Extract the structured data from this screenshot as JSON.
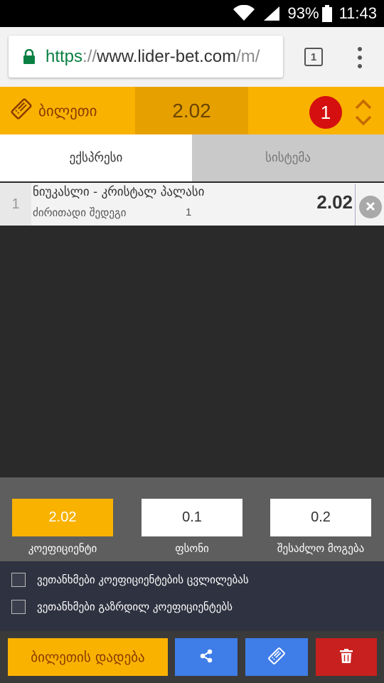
{
  "status_bar": {
    "battery_percent": "93%",
    "time": "11:43"
  },
  "browser": {
    "url_scheme": "https",
    "url_separator": "://",
    "url_host": "www.lider-bet.com",
    "url_path": "/m/",
    "tab_count": "1"
  },
  "ticket": {
    "title": "ბილეთი",
    "total_odds": "2.02",
    "selection_count": "1"
  },
  "tabs": [
    {
      "label": "ექსპრესი",
      "active": true
    },
    {
      "label": "სისტემა",
      "active": false
    }
  ],
  "bets": [
    {
      "index": "1",
      "match": "ნიუკასლი - კრისტალ პალასი",
      "market": "ძირითადი შედეგი",
      "outcome": "1",
      "odds": "2.02"
    }
  ],
  "calculator": {
    "odds_value": "2.02",
    "odds_label": "კოეფიციენტი",
    "stake_value": "0.1",
    "stake_label": "ფსონი",
    "win_value": "0.2",
    "win_label": "შესაძლო მოგება"
  },
  "agreements": [
    {
      "label": "ვეთანხმები კოეფიციენტების ცვლილებას",
      "checked": false
    },
    {
      "label": "ვეთანხმები გაზრდილ კოეფიციენტებს",
      "checked": false
    }
  ],
  "actions": {
    "place_bet_label": "ბილეთის დადება"
  },
  "colors": {
    "accent": "#f9b200",
    "blue": "#3f7de8",
    "red": "#c8201e",
    "badge_red": "#d50f0f"
  }
}
